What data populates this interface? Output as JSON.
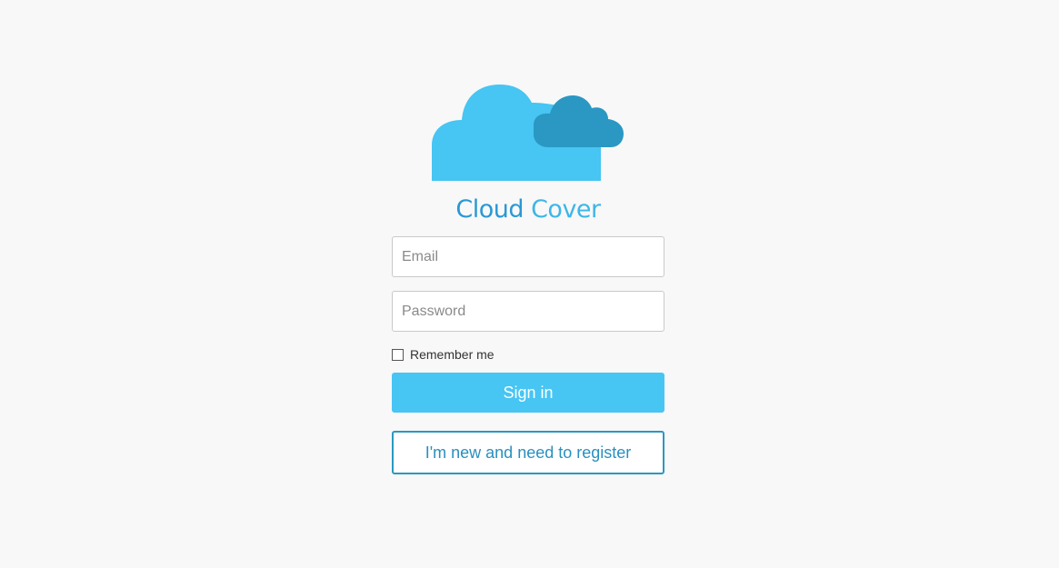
{
  "brand": {
    "word1": "Cloud",
    "word2": "Cover",
    "logo_icon": "cloud-logo-icon",
    "colors": {
      "big_cloud": "#47c5f3",
      "small_cloud": "#2a98c3",
      "title_primary": "#2a98d4",
      "title_secondary": "#3db6e8"
    }
  },
  "form": {
    "email_placeholder": "Email",
    "email_value": "",
    "password_placeholder": "Password",
    "password_value": "",
    "remember_label": "Remember me",
    "remember_checked": false,
    "signin_label": "Sign in",
    "register_label": "I'm new and need to register"
  },
  "colors": {
    "background": "#f8f8f8",
    "primary_button": "#47c5f3",
    "secondary_border": "#2a98c0"
  }
}
